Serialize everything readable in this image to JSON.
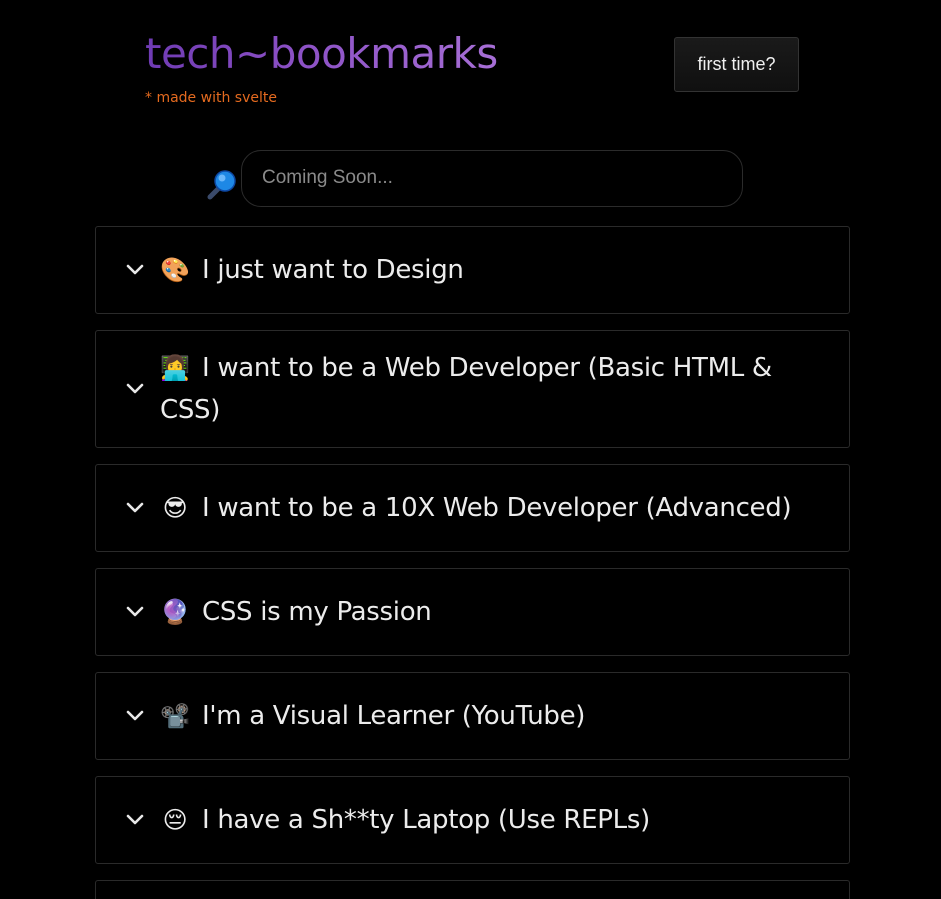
{
  "header": {
    "title": "tech~bookmarks",
    "subtitle": "* made with svelte",
    "first_time_label": "first time?"
  },
  "search": {
    "icon": "magnifying-glass-icon",
    "placeholder": "Coming Soon..."
  },
  "colors": {
    "background": "#000000",
    "title_gradient_start": "#6f3bb3",
    "title_gradient_end": "#a76fd6",
    "subtitle": "#e46a1f",
    "card_border": "#2a2a2a",
    "text": "#ececec"
  },
  "sections": [
    {
      "emoji": "🎨",
      "icon": "palette-icon",
      "label": "I just want to Design"
    },
    {
      "emoji": "👩‍💻",
      "icon": "developer-laptop-icon",
      "label": "I want to be a Web Developer (Basic HTML & CSS)"
    },
    {
      "emoji": "😎",
      "icon": "sunglasses-face-icon",
      "label": "I want to be a 10X Web Developer (Advanced)"
    },
    {
      "emoji": "🔮",
      "icon": "crystal-ball-icon",
      "label": "CSS is my Passion"
    },
    {
      "emoji": "📽️",
      "icon": "film-projector-icon",
      "label": "I'm a Visual Learner (YouTube)"
    },
    {
      "emoji": "😔",
      "icon": "pensive-face-icon",
      "label": "I have a Sh**ty Laptop (Use REPLs)"
    }
  ]
}
